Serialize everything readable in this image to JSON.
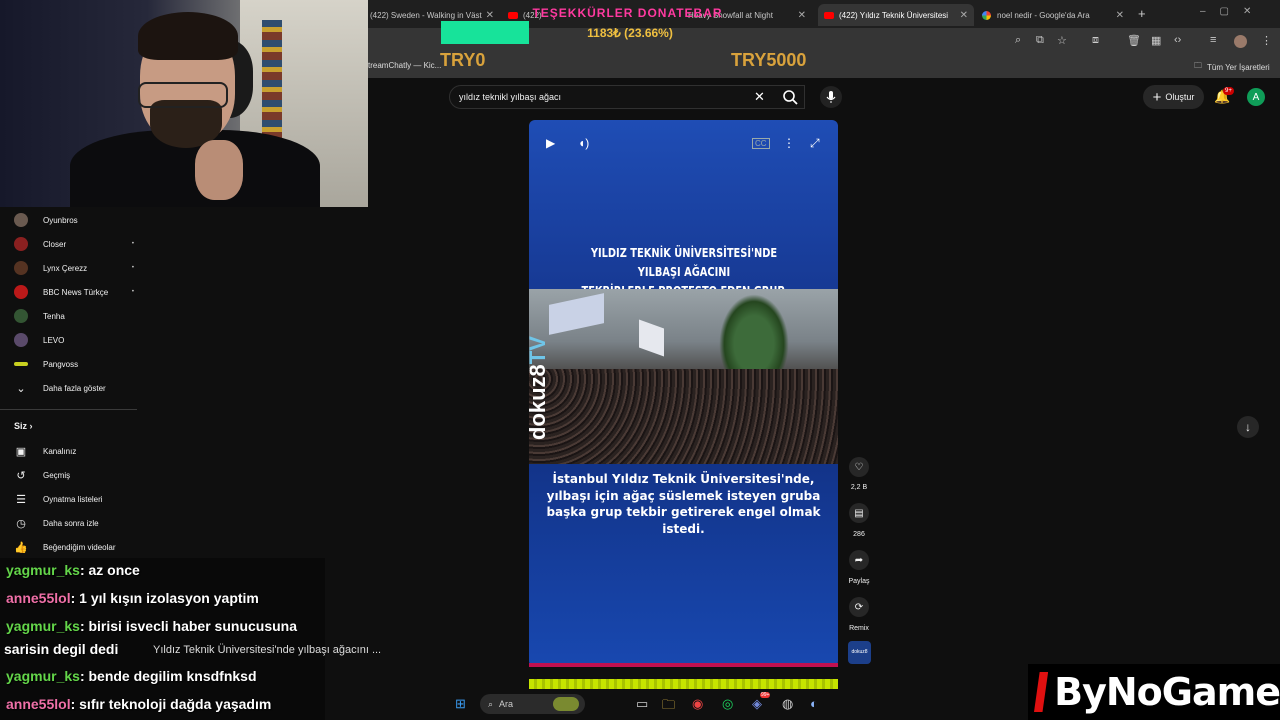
{
  "browser": {
    "tabs": [
      {
        "title": "(422) Sweden - Walking in Väst"
      },
      {
        "title": "(422) "
      },
      {
        "title": "Heavy Snowfall at Night"
      },
      {
        "title": "(422) Yıldız Teknik Üniversitesi"
      },
      {
        "title": "noel nedir - Google'da Ara"
      }
    ],
    "new_tab": "+",
    "bookmark_left": "treamChatly — Kic...",
    "bookmark_right": "Tüm Yer İşaretleri"
  },
  "donation": {
    "title": "TEŞEKKÜRLER DONATEBAR",
    "amount": "1183₺ (23.66%)",
    "progress": 0.2366,
    "min_label": "TRY0",
    "max_label": "TRY5000"
  },
  "youtube": {
    "search_value": "yıldız teknikl yılbaşı ağacı",
    "create_label": "Oluştur",
    "notif_badge": "9+",
    "avatar_letter": "A"
  },
  "sidebar": {
    "subscriptions": [
      {
        "label": "Oyunbros",
        "color": "#6a5a50",
        "dot": false
      },
      {
        "label": "Closer",
        "color": "#8a2020",
        "dot": true
      },
      {
        "label": "Lynx Çerezz",
        "color": "#553322",
        "dot": true
      },
      {
        "label": "BBC News Türkçe",
        "color": "#bb1919",
        "dot": true
      },
      {
        "label": "Tenha",
        "color": "#335533",
        "dot": false
      },
      {
        "label": "LEVO",
        "color": "#5a4a6a",
        "dot": false
      },
      {
        "label": "Pangvoss",
        "color": "#c8d020",
        "dot": false
      }
    ],
    "show_more": "Daha fazla göster",
    "section_title": "Siz",
    "you_items": [
      {
        "label": "Kanalınız",
        "icon": "channel-icon"
      },
      {
        "label": "Geçmiş",
        "icon": "history-icon"
      },
      {
        "label": "Oynatma listeleri",
        "icon": "playlists-icon"
      },
      {
        "label": "Daha sonra izle",
        "icon": "watch-later-icon"
      },
      {
        "label": "Beğendiğim videolar",
        "icon": "like-icon"
      }
    ]
  },
  "video": {
    "headline_line1": "YILDIZ TEKNİK ÜNİVERSİTESİ'NDE YILBAŞI AĞACINI",
    "headline_line2": "TEKBİRLERLE PROTESTO EDEN GRUP, NAMAZ KILDI",
    "watermark": "dokuz8",
    "watermark_tv": "TV",
    "caption": "İstanbul Yıldız Teknik Üniversitesi'nde, yılbaşı için ağaç süslemek isteyen gruba başka grup tekbir getirerek engel olmak istedi.",
    "hover_title": "Yıldız Teknik Üniversitesi'nde yılbaşı ağacını ...",
    "channel_thumb": "dokuz8"
  },
  "actions": {
    "likes": "2,2 B",
    "comments": "286",
    "share": "Paylaş",
    "remix": "Remix"
  },
  "chat": [
    {
      "user": "yagmur_ks",
      "text": ": az once",
      "color": "#64d64a"
    },
    {
      "user": "anne55lol",
      "text": ": 1 yıl kışın izolasyon yaptim",
      "color": "#f070a8"
    },
    {
      "user": "yagmur_ks",
      "text": ": birisi isvecli haber sunucusuna",
      "color": "#64d64a"
    },
    {
      "user": "",
      "text": "sarisin degil dedi",
      "color": "#ffffff"
    },
    {
      "user": "yagmur_ks",
      "text": ": bende degilim knsdfnksd",
      "color": "#64d64a"
    },
    {
      "user": "anne55lol",
      "text": ": sıfır teknoloji dağda yaşadım",
      "color": "#f070a8"
    }
  ],
  "taskbar": {
    "search_label": "Ara",
    "discord_badge": "99+"
  },
  "logo": {
    "text": "ByNoGame"
  }
}
